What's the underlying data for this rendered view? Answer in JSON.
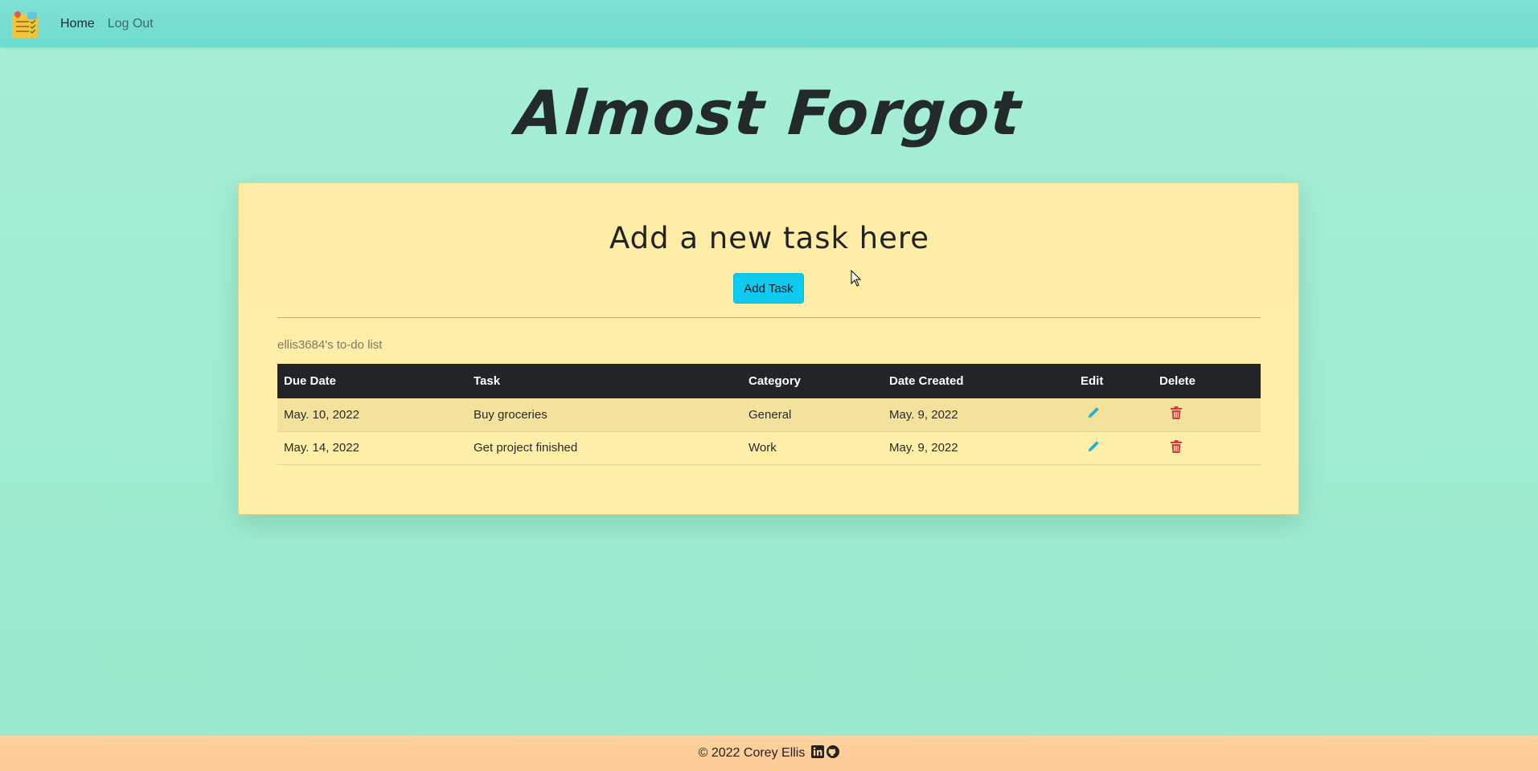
{
  "navbar": {
    "logo_icon": "notepad-checklist-icon",
    "links": [
      {
        "label": "Home",
        "active": true
      },
      {
        "label": "Log Out",
        "active": false
      }
    ]
  },
  "site_title": "Almost Forgot",
  "card": {
    "heading": "Add a new task here",
    "add_button_label": "Add Task",
    "list_caption": "ellis3684's to-do list",
    "table": {
      "headers": [
        "Due Date",
        "Task",
        "Category",
        "Date Created",
        "Edit",
        "Delete"
      ],
      "rows": [
        {
          "due_date": "May. 10, 2022",
          "task": "Buy groceries",
          "category": "General",
          "date_created": "May. 9, 2022",
          "edit_icon": "pencil-icon",
          "delete_icon": "trash-icon"
        },
        {
          "due_date": "May. 14, 2022",
          "task": "Get project finished",
          "category": "Work",
          "date_created": "May. 9, 2022",
          "edit_icon": "pencil-icon",
          "delete_icon": "trash-icon"
        }
      ]
    }
  },
  "footer": {
    "copyright": "© 2022 Corey Ellis",
    "social_icons": [
      "linkedin-icon",
      "github-icon"
    ]
  },
  "colors": {
    "background": "#a5eed5",
    "navbar": "#7fe0d4",
    "card": "#fff0a8",
    "button": "#0dcaf0",
    "table_header": "#212529",
    "edit_icon": "#17b4dd",
    "delete_icon": "#dc3545",
    "footer": "#fdd19e"
  }
}
